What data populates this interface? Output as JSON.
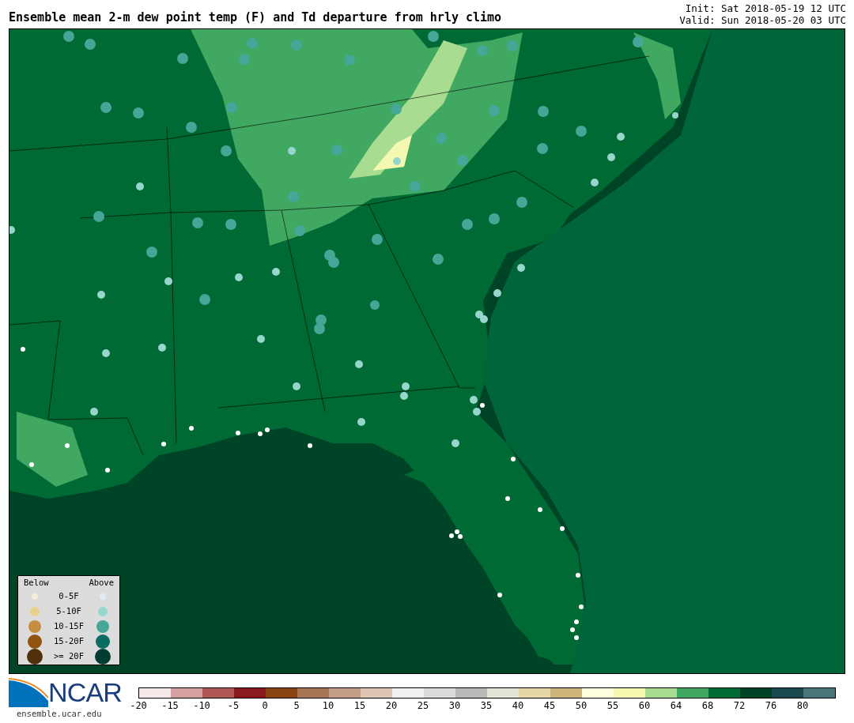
{
  "title": "Ensemble mean 2-m dew point temp (F) and Td departure from hrly climo",
  "init": "Init: Sat 2018-05-19 12 UTC",
  "valid": "Valid: Sun 2018-05-20 03 UTC",
  "legend": {
    "below_heading": "Below",
    "above_heading": "Above",
    "rows": [
      {
        "label": "0-5F",
        "below": {
          "color": "#f7ecd6"
        },
        "above": {
          "color": "#dceff0"
        }
      },
      {
        "label": "5-10F",
        "below": {
          "color": "#ead08e"
        },
        "above": {
          "color": "#97d6cc"
        }
      },
      {
        "label": "10-15F",
        "below": {
          "color": "#c68e40"
        },
        "above": {
          "color": "#46a698"
        }
      },
      {
        "label": "15-20F",
        "below": {
          "color": "#925411"
        },
        "above": {
          "color": "#0b6c62"
        }
      },
      {
        "label": ">= 20F",
        "below": {
          "color": "#50300a"
        },
        "above": {
          "color": "#003c30"
        }
      }
    ]
  },
  "logo": {
    "wordmark": "NCAR",
    "url": "ensemble.ucar.edu"
  },
  "colorbar": {
    "segments": [
      {
        "color": "#f6e9e9",
        "label": "-20"
      },
      {
        "color": "#d4a0a0",
        "label": "-15"
      },
      {
        "color": "#b05858",
        "label": "-10"
      },
      {
        "color": "#8b1820",
        "label": "-5"
      },
      {
        "color": "#8b4513",
        "label": "0"
      },
      {
        "color": "#a87654",
        "label": "5"
      },
      {
        "color": "#c49e85",
        "label": "10"
      },
      {
        "color": "#dfc5b4",
        "label": "15"
      },
      {
        "color": "#f0f0f0",
        "label": "20"
      },
      {
        "color": "#dcdcdc",
        "label": "25"
      },
      {
        "color": "#bababa",
        "label": "30"
      },
      {
        "color": "#e3e3d6",
        "label": "35"
      },
      {
        "color": "#e6d6a8",
        "label": "40"
      },
      {
        "color": "#ccb47a",
        "label": "45"
      },
      {
        "color": "#ffffe0",
        "label": "50"
      },
      {
        "color": "#f5f8b0",
        "label": "55"
      },
      {
        "color": "#a8dc90",
        "label": "60"
      },
      {
        "color": "#40a860",
        "label": "64"
      },
      {
        "color": "#006a35",
        "label": "68"
      },
      {
        "color": "#004428",
        "label": "72"
      },
      {
        "color": "#1a4a50",
        "label": "76"
      },
      {
        "color": "#4a7578",
        "label": "80"
      }
    ]
  }
}
